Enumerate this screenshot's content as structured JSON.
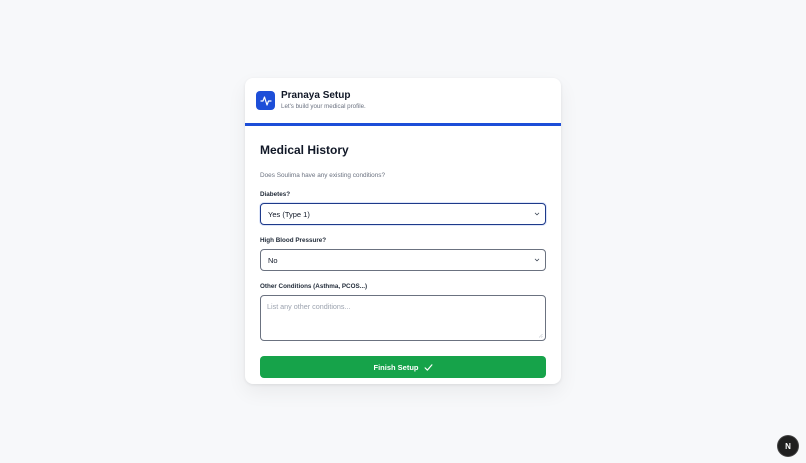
{
  "header": {
    "title": "Pranaya Setup",
    "subtitle": "Let's build your medical profile.",
    "logo_icon": "activity-pulse-icon",
    "accent_color": "#1d4ed8"
  },
  "form": {
    "section_title": "Medical History",
    "section_description": "Does Soulima have any existing conditions?",
    "diabetes": {
      "label": "Diabetes?",
      "selected_value": "Yes (Type 1)"
    },
    "blood_pressure": {
      "label": "High Blood Pressure?",
      "selected_value": "No"
    },
    "other_conditions": {
      "label": "Other Conditions (Asthma, PCOS...)",
      "value": "",
      "placeholder": "List any other conditions..."
    },
    "submit": {
      "label": "Finish Setup",
      "icon": "checkmark-icon",
      "color": "#16a34a"
    }
  },
  "badge": {
    "label": "N"
  }
}
